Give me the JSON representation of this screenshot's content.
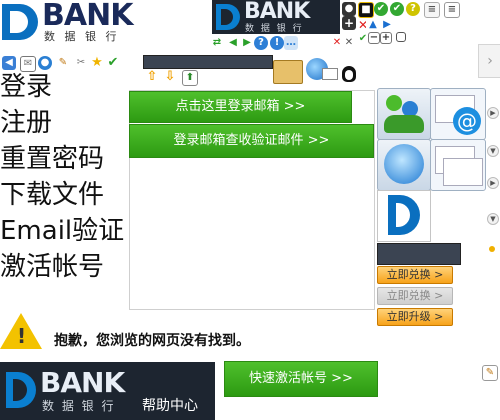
{
  "logo_main": {
    "brand": "BANK",
    "subtitle": "数 据 银 行"
  },
  "logo_top": {
    "brand": "BANK",
    "subtitle": "数 据 银 行"
  },
  "nav": {
    "login": "登录",
    "register": "注册",
    "reset_password": "重置密码",
    "download": "下载文件",
    "email_verify": "Email验证",
    "activate": "激活帐号"
  },
  "buttons": {
    "login_mailbox": "点击这里登录邮箱 >>",
    "check_mail": "登录邮箱查收验证邮件 >>",
    "quick_activate": "快速激活帐号 >>"
  },
  "side_buttons": {
    "redeem_1": "立即兑换 >",
    "redeem_2": "立即兑换 >",
    "upgrade": "立即升级 >"
  },
  "error_message": "抱歉，您浏览的网页没有找到。",
  "footer_logo": {
    "brand": "BANK",
    "subtitle": "数 据 银 行",
    "help": "帮助中心"
  },
  "icons": [
    "user-icon",
    "lock-icon",
    "question-icon",
    "check-icon",
    "mail-icon",
    "star-icon",
    "wrench-icon",
    "folder-icon",
    "upload-icon",
    "download-icon",
    "globe-icon",
    "warning-icon",
    "edit-icon",
    "close-icon"
  ]
}
